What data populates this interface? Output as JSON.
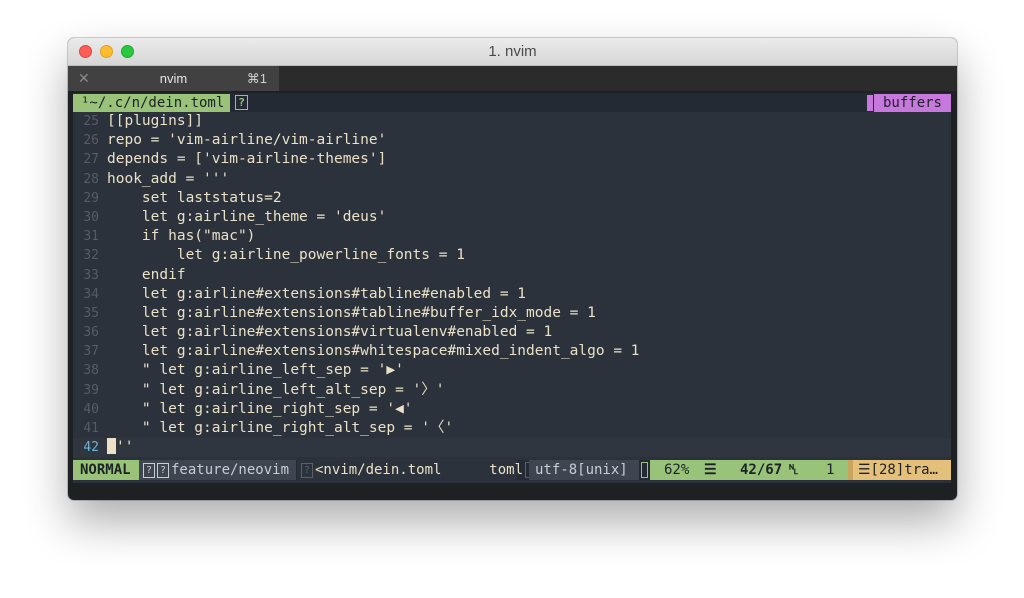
{
  "window": {
    "title": "1. nvim"
  },
  "tab": {
    "close_glyph": "✕",
    "label": "nvim",
    "shortcut": "⌘1"
  },
  "tabline": {
    "file": "¹~/.c/n/dein.toml",
    "unknown_glyph": "?",
    "buffers_label": "buffers"
  },
  "lines": [
    {
      "num": "25",
      "text": "[[plugins]]"
    },
    {
      "num": "26",
      "text": "repo = 'vim-airline/vim-airline'"
    },
    {
      "num": "27",
      "text": "depends = ['vim-airline-themes']"
    },
    {
      "num": "28",
      "text": "hook_add = '''"
    },
    {
      "num": "29",
      "text": "    set laststatus=2"
    },
    {
      "num": "30",
      "text": "    let g:airline_theme = 'deus'"
    },
    {
      "num": "31",
      "text": "    if has(\"mac\")"
    },
    {
      "num": "32",
      "text": "        let g:airline_powerline_fonts = 1"
    },
    {
      "num": "33",
      "text": "    endif"
    },
    {
      "num": "34",
      "text": "    let g:airline#extensions#tabline#enabled = 1"
    },
    {
      "num": "35",
      "text": "    let g:airline#extensions#tabline#buffer_idx_mode = 1"
    },
    {
      "num": "36",
      "text": "    let g:airline#extensions#virtualenv#enabled = 1"
    },
    {
      "num": "37",
      "text": "    let g:airline#extensions#whitespace#mixed_indent_algo = 1"
    },
    {
      "num": "38",
      "text": "    \" let g:airline_left_sep = '▶'"
    },
    {
      "num": "39",
      "text": "    \" let g:airline_left_alt_sep = '〉'"
    },
    {
      "num": "40",
      "text": "    \" let g:airline_right_sep = '◀'"
    },
    {
      "num": "41",
      "text": "    \" let g:airline_right_alt_sep = '〈'"
    }
  ],
  "current_line": {
    "num": "42",
    "text": "''"
  },
  "statusline": {
    "mode": "NORMAL",
    "branch_icon": "?",
    "branch_icon2": "?",
    "branch": "feature/neovim",
    "file_icon": "?",
    "file": "<nvim/dein.toml",
    "filetype": "toml",
    "encoding": "utf-8[unix]",
    "percent": "62%",
    "menu_glyph": "☰",
    "line_pos": "42/67",
    "ln_glyph": "␤",
    "col": "1",
    "warning": "☰[28]tra…"
  },
  "colors": {
    "mode_green": "#98c379",
    "buffers_purple": "#c678dd",
    "warning_yellow": "#e5c07b",
    "editor_bg": "#2c323b",
    "text_fg": "#eae1c7"
  }
}
